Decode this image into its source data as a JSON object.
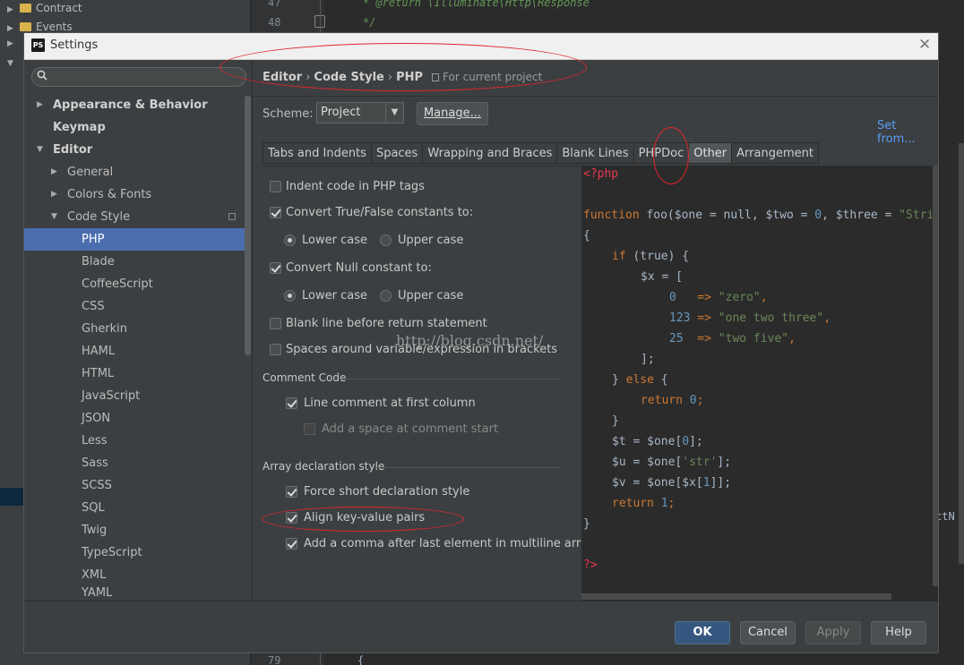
{
  "background": {
    "tree": [
      {
        "label": "Contract"
      },
      {
        "label": "Events"
      }
    ],
    "line_numbers": [
      "47",
      "48",
      "79"
    ],
    "code_lines": [
      "* @return \\Illuminate\\Http\\Response",
      "*/",
      "{"
    ],
    "right_fragment": "ctN"
  },
  "dialog": {
    "title": "Settings",
    "logo": "PS"
  },
  "sidebar": {
    "items": [
      {
        "label": "Appearance & Behavior"
      },
      {
        "label": "Keymap"
      },
      {
        "label": "Editor"
      },
      {
        "label": "General"
      },
      {
        "label": "Colors & Fonts"
      },
      {
        "label": "Code Style"
      },
      {
        "label": "PHP"
      },
      {
        "label": "Blade"
      },
      {
        "label": "CoffeeScript"
      },
      {
        "label": "CSS"
      },
      {
        "label": "Gherkin"
      },
      {
        "label": "HAML"
      },
      {
        "label": "HTML"
      },
      {
        "label": "JavaScript"
      },
      {
        "label": "JSON"
      },
      {
        "label": "Less"
      },
      {
        "label": "Sass"
      },
      {
        "label": "SCSS"
      },
      {
        "label": "SQL"
      },
      {
        "label": "Twig"
      },
      {
        "label": "TypeScript"
      },
      {
        "label": "XML"
      },
      {
        "label": "YAML"
      }
    ]
  },
  "breadcrumb": {
    "parts": [
      "Editor",
      "Code Style",
      "PHP"
    ],
    "sep": "›",
    "project_note": "For current project"
  },
  "scheme": {
    "label": "Scheme:",
    "value": "Project",
    "manage_label": "Manage...",
    "set_from": "Set from..."
  },
  "tabs": [
    {
      "label": "Tabs and Indents"
    },
    {
      "label": "Spaces"
    },
    {
      "label": "Wrapping and Braces"
    },
    {
      "label": "Blank Lines"
    },
    {
      "label": "PHPDoc"
    },
    {
      "label": "Other"
    },
    {
      "label": "Arrangement"
    }
  ],
  "options": {
    "indent_php": "Indent code in PHP tags",
    "convert_bool": "Convert True/False constants to:",
    "lower_case": "Lower case",
    "upper_case": "Upper case",
    "convert_null": "Convert Null constant to:",
    "blank_line": "Blank line before return statement",
    "spaces_around": "Spaces around variable/expression in brackets",
    "comment_group": "Comment Code",
    "line_comment": "Line comment at first column",
    "add_space": "Add a space at comment start",
    "array_group": "Array declaration style",
    "force_short": "Force short declaration style",
    "align_kv": "Align key-value pairs",
    "add_comma": "Add a comma after last element in multiline array"
  },
  "preview": {
    "l1": "<?php",
    "l3_kw": "function",
    "l3_rest": " foo($one = null, $two = ",
    "l3_n": "0",
    "l3_rest2": ", $three = ",
    "l3_str": "\"Stri",
    "brace_open": "{",
    "if_kw": "if",
    "if_rest": " (true) {",
    "x_assign": "$x = [",
    "k0": "0",
    "arrow": "   =>",
    "v0": "\"zero\"",
    "k1": "123",
    "arrow1": " =>",
    "v1": "\"one two three\"",
    "k2": "25",
    "arrow2": "  =>",
    "v2": "\"two five\"",
    "comma": ",",
    "close_arr": "];",
    "else_pre": "} ",
    "else_kw": "else",
    "else_post": " {",
    "return_kw": "return",
    "ret0": "0",
    "semi": ";",
    "brace_close": "}",
    "t_line": "$t = $one[",
    "t_n": "0",
    "t_end": "];",
    "u_line": "$u = $one[",
    "u_str": "'str'",
    "u_end": "];",
    "v_line": "$v = $one[$x[",
    "v_n": "1",
    "v_end": "]];",
    "ret1": "1",
    "end_tag": "?>"
  },
  "buttons": {
    "ok": "OK",
    "cancel": "Cancel",
    "apply": "Apply",
    "help": "Help"
  },
  "watermark": "http://blog.csdn.net/"
}
